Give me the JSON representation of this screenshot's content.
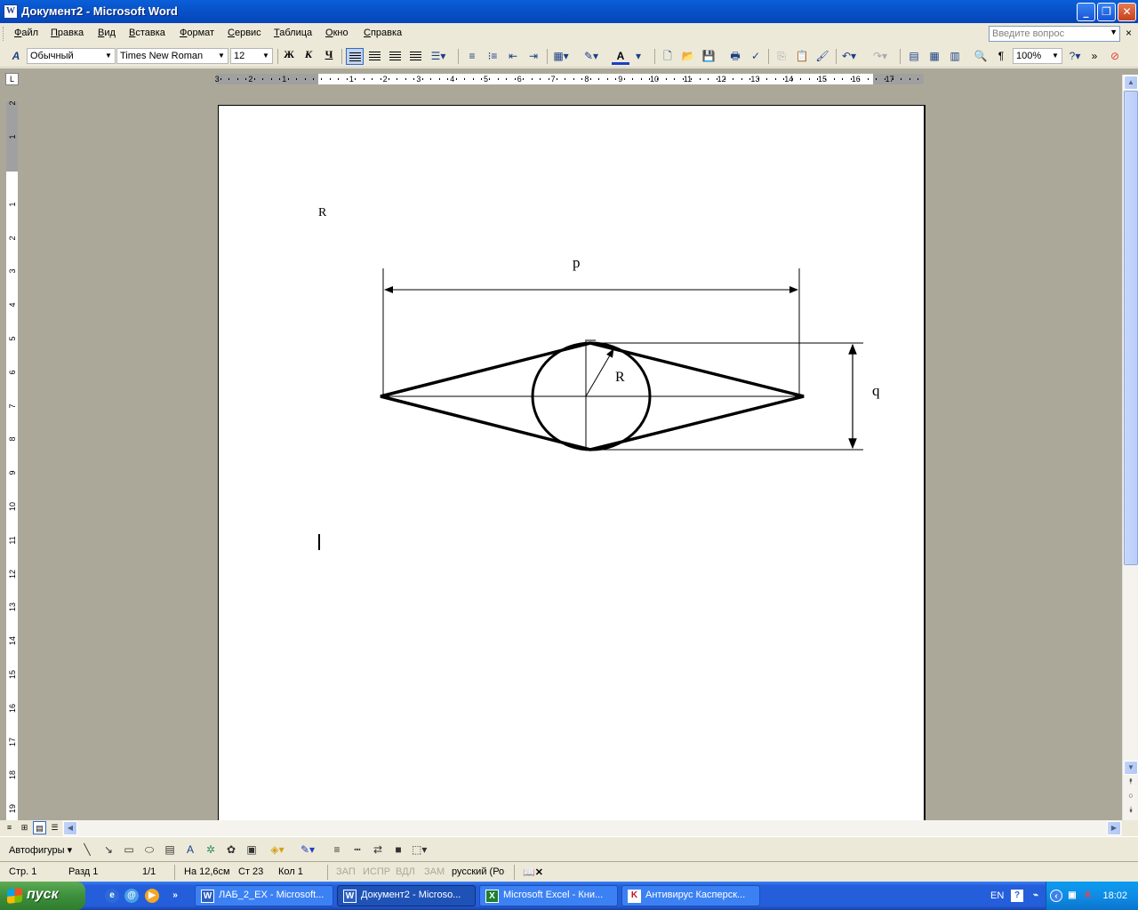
{
  "window": {
    "title": "Документ2 - Microsoft Word",
    "icon_letter": "W"
  },
  "menu": {
    "items": [
      "Файл",
      "Правка",
      "Вид",
      "Вставка",
      "Формат",
      "Сервис",
      "Таблица",
      "Окно",
      "Справка"
    ],
    "help_placeholder": "Введите вопрос"
  },
  "toolbar": {
    "style": "Обычный",
    "font": "Times New Roman",
    "size": "12",
    "bold": "Ж",
    "italic": "К",
    "underline": "Ч",
    "zoom": "100%"
  },
  "ruler": {
    "h_labels_left": [
      "3",
      "2",
      "1"
    ],
    "h_labels": [
      "1",
      "2",
      "3",
      "4",
      "5",
      "6",
      "7",
      "8",
      "9",
      "10",
      "11",
      "12",
      "13",
      "14",
      "15",
      "16",
      "17"
    ],
    "v_labels_top": [
      "2",
      "1"
    ],
    "v_labels": [
      "1",
      "2",
      "3",
      "4",
      "5",
      "6",
      "7",
      "8",
      "9",
      "10",
      "11",
      "12",
      "13",
      "14",
      "15",
      "16",
      "17",
      "18",
      "19"
    ]
  },
  "document": {
    "text_r": "R",
    "figure": {
      "label_p": "p",
      "label_q": "q",
      "label_r": "R"
    }
  },
  "drawing_toolbar": {
    "autoshapes": "Автофигуры"
  },
  "status": {
    "page": "Стр. 1",
    "section": "Разд 1",
    "pages": "1/1",
    "at": "На 12,6см",
    "line": "Ст 23",
    "col": "Кол 1",
    "rec": "ЗАП",
    "trk": "ИСПР",
    "ext": "ВДЛ",
    "ovr": "ЗАМ",
    "lang": "русский (Ро"
  },
  "taskbar": {
    "start": "пуск",
    "buttons": [
      {
        "label": "ЛАБ_2_ЕХ - Microsoft...",
        "icon": "W"
      },
      {
        "label": "Документ2 - Microso...",
        "icon": "W",
        "active": true
      },
      {
        "label": "Microsoft Excel - Кни...",
        "icon": "X"
      },
      {
        "label": "Антивирус Касперск...",
        "icon": "K"
      }
    ],
    "lang": "EN",
    "clock": "18:02"
  }
}
